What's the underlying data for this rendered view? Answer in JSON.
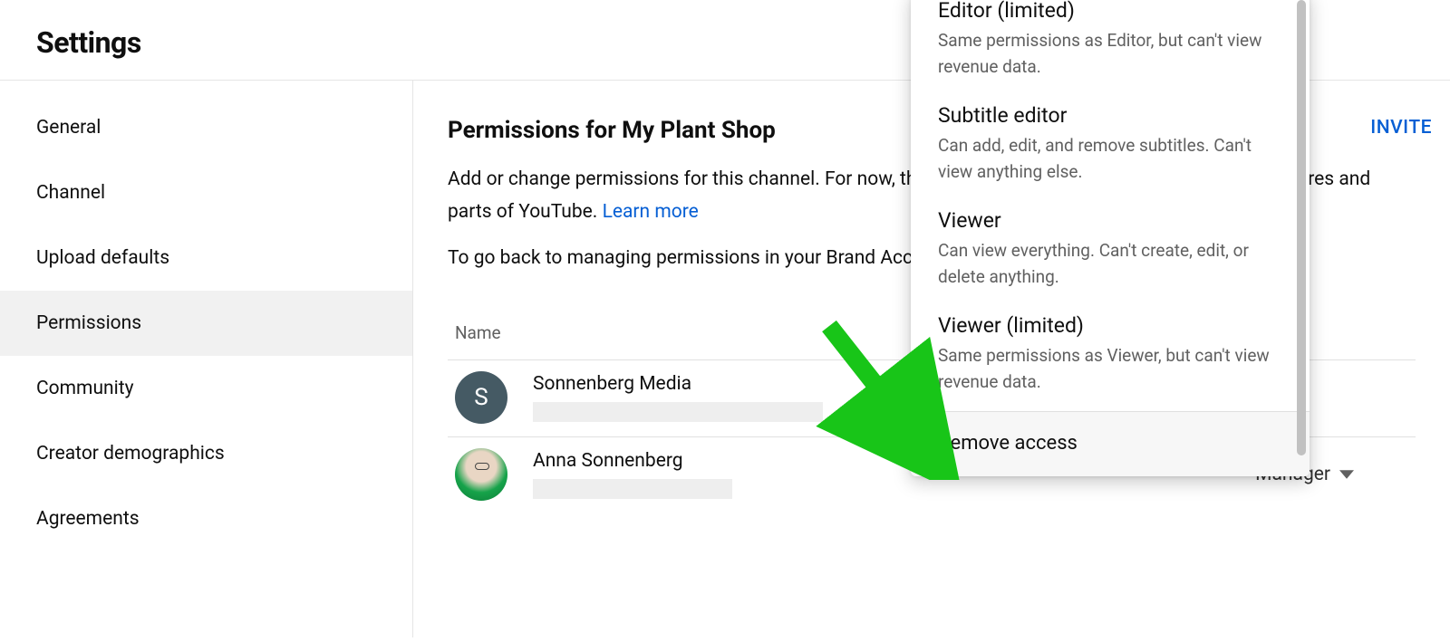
{
  "header": {
    "title": "Settings"
  },
  "sidebar": {
    "items": [
      {
        "label": "General"
      },
      {
        "label": "Channel"
      },
      {
        "label": "Upload defaults"
      },
      {
        "label": "Permissions",
        "active": true
      },
      {
        "label": "Community"
      },
      {
        "label": "Creator demographics"
      },
      {
        "label": "Agreements"
      }
    ]
  },
  "main": {
    "title": "Permissions for My Plant Shop",
    "description_pre": "Add or change permissions for this channel. For now, the people you invite can only grant limited features and parts of YouTube. ",
    "learn_more": "Learn more",
    "goback": "To go back to managing permissions in your Brand Account, switch back to Brand Account.",
    "invite_label": "INVITE",
    "table": {
      "header_name": "Name",
      "rows": [
        {
          "name": "Sonnenberg Media",
          "avatar_letter": "S",
          "role": ""
        },
        {
          "name": "Anna Sonnenberg",
          "role": "Manager"
        }
      ]
    }
  },
  "dropdown": {
    "options": [
      {
        "title": "Editor (limited)",
        "desc": "Same permissions as Editor, but can't view revenue data."
      },
      {
        "title": "Subtitle editor",
        "desc": "Can add, edit, and remove subtitles. Can't view anything else."
      },
      {
        "title": "Viewer",
        "desc": "Can view everything. Can't create, edit, or delete anything."
      },
      {
        "title": "Viewer (limited)",
        "desc": "Same permissions as Viewer, but can't view revenue data."
      }
    ],
    "remove_label": "Remove access"
  }
}
